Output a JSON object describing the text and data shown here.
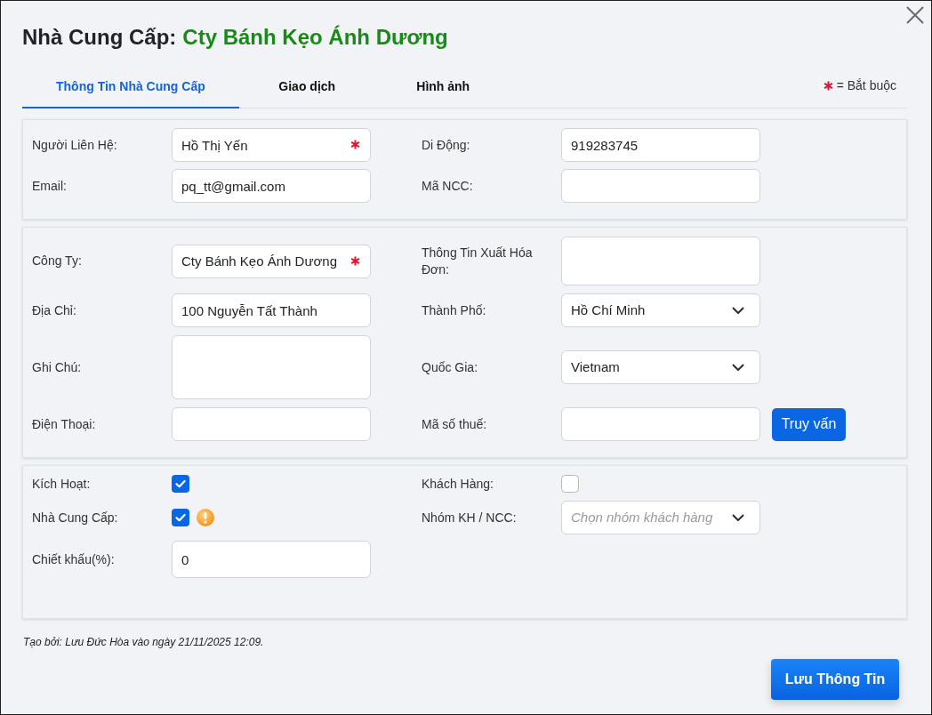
{
  "header": {
    "title": "Nhà Cung Cấp:",
    "supplier_name": "Cty Bánh Kẹo Ánh Dương"
  },
  "tabs": [
    {
      "label": "Thông Tin Nhà Cung Cấp",
      "selected": true
    },
    {
      "label": "Giao dịch",
      "selected": false
    },
    {
      "label": "Hình ảnh",
      "selected": false
    }
  ],
  "required_note": "= Bắt buộc",
  "sections": [
    {
      "rows": [
        {
          "fields": [
            {
              "label": "Người Liên Hệ:",
              "kind": "text",
              "value": "Hồ Thị Yến",
              "required": true
            },
            {
              "label": "Di Động:",
              "kind": "text",
              "value": "919283745",
              "required": false
            }
          ]
        },
        {
          "fields": [
            {
              "label": "Email:",
              "kind": "text",
              "value": "pq_tt@gmail.com",
              "required": false
            },
            {
              "label": "Mã NCC:",
              "kind": "text",
              "required": false
            }
          ]
        }
      ]
    },
    {
      "rows": [
        {
          "fields": [
            {
              "label": "Công Ty:",
              "kind": "text",
              "value": "Cty Bánh Kẹo Ánh Dương",
              "required": true
            },
            {
              "label": "Thông Tin Xuất Hóa Đơn:",
              "kind": "textarea",
              "required": false
            }
          ]
        },
        {
          "fields": [
            {
              "label": "Địa Chỉ:",
              "kind": "text",
              "value": "100 Nguyễn Tất Thành",
              "required": false
            },
            {
              "label": "Thành Phố:",
              "kind": "select",
              "value": "Hồ Chí Minh",
              "required": false
            }
          ]
        },
        {
          "fields": [
            {
              "label": "Ghi Chú:",
              "kind": "textarea",
              "required": false
            },
            {
              "label": "Quốc Gia:",
              "kind": "select",
              "value": "Vietnam",
              "required": false
            }
          ]
        },
        {
          "fields": [
            {
              "label": "Điện Thoại:",
              "kind": "text",
              "required": false
            },
            {
              "label": "Mã số thuế:",
              "kind": "text",
              "required": false,
              "button": "Truy vấn"
            }
          ]
        }
      ]
    },
    {
      "rows": [
        {
          "fields": [
            {
              "label": "Kích Hoạt:",
              "kind": "checkbox",
              "checked": true,
              "warning": false
            },
            {
              "label": "Khách Hàng:",
              "kind": "checkbox",
              "checked": false,
              "warning": false
            }
          ]
        },
        {
          "fields": [
            {
              "label": "Nhà Cung Cấp:",
              "kind": "checkbox",
              "checked": true,
              "warning": true
            },
            {
              "label": "Nhóm KH / NCC:",
              "kind": "select",
              "placeholder": "Chọn nhóm khách hàng",
              "required": false
            }
          ]
        },
        {
          "fields": [
            {
              "label": "Chiết khấu(%):",
              "kind": "number",
              "value": "0",
              "required": false
            }
          ]
        }
      ]
    }
  ],
  "created_note": "Tạo bởi: Lưu Đức Hòa vào ngày 21/11/2025 12:09.",
  "save_button": "Lưu Thông Tin"
}
